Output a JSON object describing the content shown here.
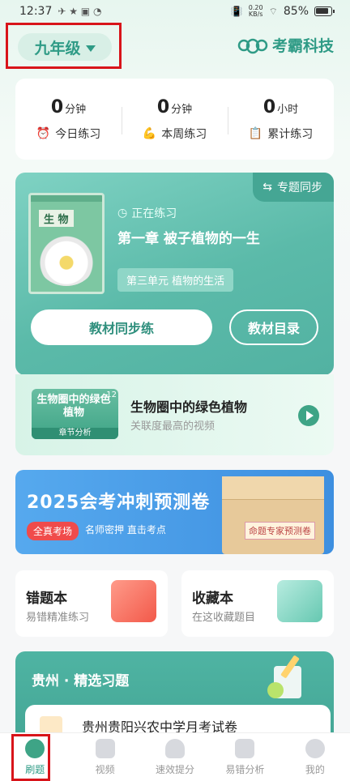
{
  "status": {
    "time": "12:37",
    "speed_num": "0.20",
    "speed_unit": "KB/s",
    "battery": "85%"
  },
  "header": {
    "grade": "九年级",
    "brand": "考霸科技"
  },
  "stats": [
    {
      "num": "0",
      "unit": "分钟",
      "icon": "⏰",
      "label": "今日练习"
    },
    {
      "num": "0",
      "unit": "分钟",
      "icon": "💪",
      "label": "本周练习"
    },
    {
      "num": "0",
      "unit": "小时",
      "icon": "📋",
      "label": "累计练习"
    }
  ],
  "practice": {
    "sync_tag": "专题同步",
    "book_title": "生 物",
    "status": "正在练习",
    "chapter": "第一章 被子植物的一生",
    "unit": "第三单元 植物的生活",
    "btn_sync": "教材同步练",
    "btn_catalog": "教材目录"
  },
  "video": {
    "thumb_text": "生物圈中的绿色植物",
    "thumb_foot": "章节分析",
    "thumb_badge": "12",
    "title": "生物圈中的绿色植物",
    "subtitle": "关联度最高的视频"
  },
  "banner": {
    "title": "2025会考冲刺预测卷",
    "hot": "全真考场",
    "sub": "名师密押 直击考点",
    "envelope_label": "命题专家预测卷"
  },
  "tiles": {
    "mistakes": {
      "title": "错题本",
      "sub": "易错精准练习"
    },
    "favorites": {
      "title": "收藏本",
      "sub": "在这收藏题目"
    }
  },
  "region": {
    "title": "贵州 · 精选习题",
    "exam_title": "贵州贵阳兴农中学月考试卷"
  },
  "tabs": [
    "刷题",
    "视频",
    "速效提分",
    "易错分析",
    "我的"
  ]
}
